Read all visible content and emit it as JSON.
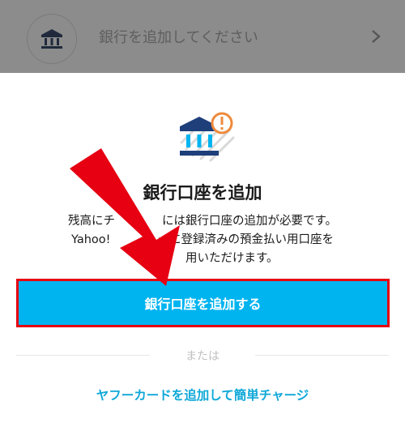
{
  "top_row": {
    "label": "銀行を追加してください"
  },
  "dialog": {
    "title": "銀行口座を追加",
    "description_lines": [
      "残高にチ　　　　には銀行口座の追加が必要です。",
      "Yahoo!　　　　ーに登録済みの預金払い用口座を",
      "　　　　　用いただけます。"
    ],
    "primary_button": "銀行口座を追加する",
    "divider_text": "または",
    "secondary_link": "ヤフーカードを追加して簡単チャージ"
  },
  "colors": {
    "accent": "#00b4f0",
    "highlight_border": "#e60012",
    "link": "#0fa8d8",
    "arrow": "#e60012",
    "warning": "#ee8a3c",
    "bank_icon": "#1e3f7a"
  }
}
